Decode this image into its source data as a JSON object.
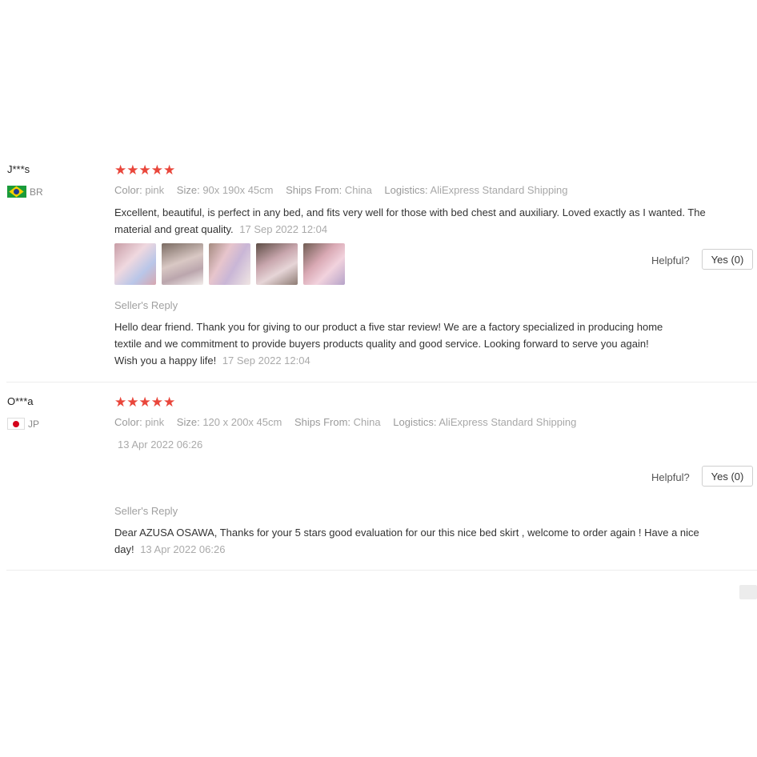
{
  "reviews": [
    {
      "user": "J***s",
      "country": "BR",
      "stars": "★★★★★",
      "meta": {
        "color_label": "Color:",
        "color_value": "pink",
        "size_label": "Size:",
        "size_value": "90x 190x 45cm",
        "ships_label": "Ships From:",
        "ships_value": "China",
        "logistics_label": "Logistics:",
        "logistics_value": "AliExpress Standard Shipping"
      },
      "text": "Excellent, beautiful, is perfect in any bed, and fits very well for those with bed chest and auxiliary. Loved exactly as I wanted. The material and great quality.",
      "time": "17 Sep 2022 12:04",
      "photos": [
        "bedding-photo-1",
        "bedding-photo-2",
        "bedding-photo-3",
        "bedding-photo-4",
        "bedding-photo-5"
      ],
      "helpful_label": "Helpful?",
      "yes_label": "Yes (0)",
      "seller_reply_label": "Seller's Reply",
      "seller_reply_text": "Hello dear friend. Thank you for giving to our product a five star review! We are a factory specialized in producing home textile and we commitment to provide buyers products quality and good service. Looking forward to serve you again! Wish you a happy life!",
      "seller_reply_time": "17 Sep 2022 12:04"
    },
    {
      "user": "O***a",
      "country": "JP",
      "stars": "★★★★★",
      "meta": {
        "color_label": "Color:",
        "color_value": "pink",
        "size_label": "Size:",
        "size_value": "120 x 200x 45cm",
        "ships_label": "Ships From:",
        "ships_value": "China",
        "logistics_label": "Logistics:",
        "logistics_value": "AliExpress Standard Shipping"
      },
      "time": "13 Apr 2022 06:26",
      "helpful_label": "Helpful?",
      "yes_label": "Yes (0)",
      "seller_reply_label": "Seller's Reply",
      "seller_reply_text": "Dear AZUSA OSAWA, Thanks for your 5 stars good evaluation for our this nice bed skirt , welcome to order again ! Have a nice day!",
      "seller_reply_time": "13 Apr 2022 06:26"
    }
  ],
  "colors": {
    "star": "#e9463b",
    "muted": "#a8a8a8",
    "text": "#333333",
    "border": "#cfcfcf"
  }
}
